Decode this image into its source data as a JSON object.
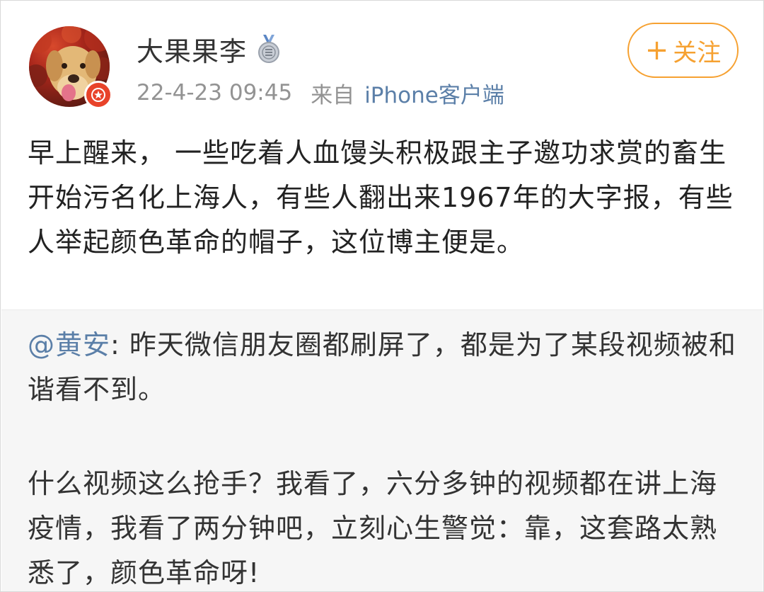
{
  "user": {
    "name": "大果果李",
    "medal_icon": "medal-icon",
    "verify_icon": "verified-badge-icon",
    "avatar_alt": "dog-avatar",
    "accent_color": "#e8432a"
  },
  "meta": {
    "timestamp": "22-4-23 09:45",
    "source_prefix": "来自",
    "source_client": "iPhone客户端"
  },
  "follow_button": {
    "plus": "+",
    "label": "关注",
    "color": "#f6a131"
  },
  "post": {
    "text": "早上醒来， 一些吃着人血馒头积极跟主子邀功求赏的畜生开始污名化上海人，有些人翻出来1967年的大字报，有些人举起颜色革命的帽子，这位博主便是。"
  },
  "retweet": {
    "mention": "@黄安",
    "text_1": ": 昨天微信朋友圈都刷屏了，都是为了某段视频被和谐看不到。",
    "text_2": "什么视频这么抢手？我看了，六分多钟的视频都在讲上海疫情，我看了两分钟吧，立刻心生警觉：靠，这套路太熟悉了，颜色革命呀!",
    "mention_color": "#5b7fa8",
    "background": "#f6f6f6"
  }
}
